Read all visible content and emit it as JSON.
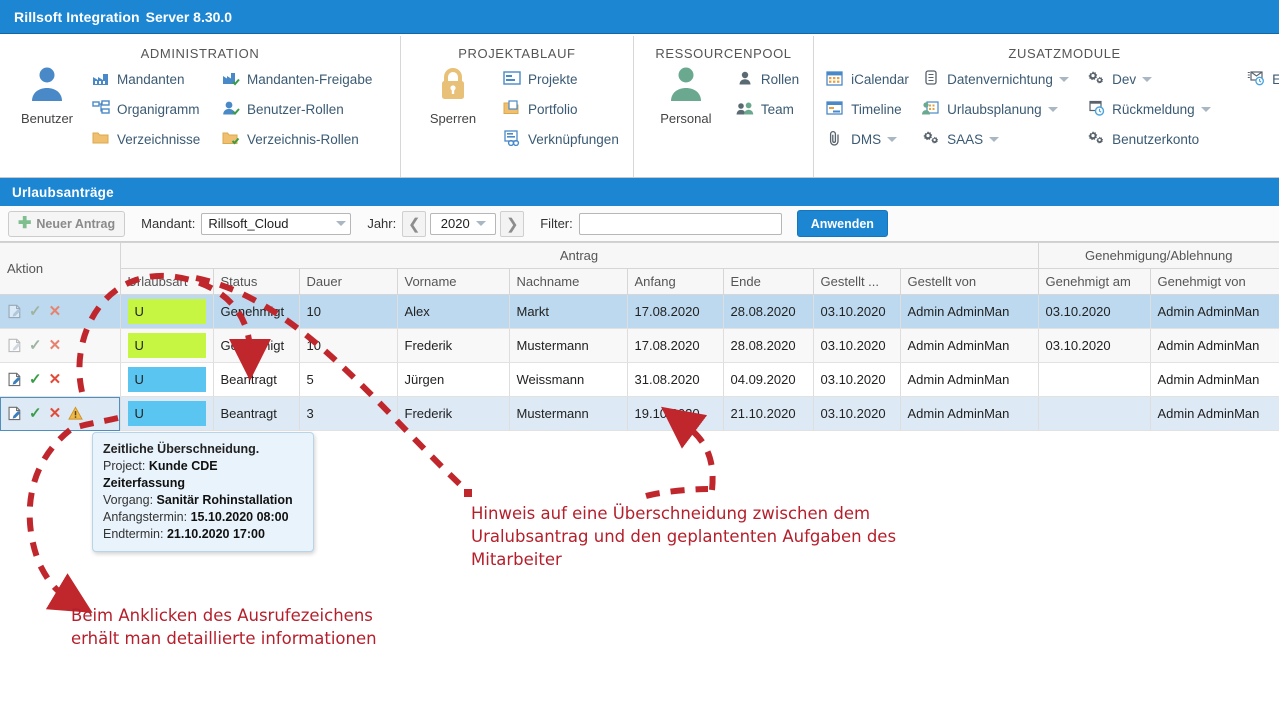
{
  "window": {
    "title_main": "Rillsoft Integration",
    "title_version": "Server 8.30.0"
  },
  "ribbon": {
    "groups": [
      {
        "title": "ADMINISTRATION",
        "big_button": {
          "label": "Benutzer",
          "icon": "user-icon"
        },
        "columns": [
          [
            {
              "label": "Mandanten",
              "icon": "factory-icon"
            },
            {
              "label": "Organigramm",
              "icon": "org-chart-icon"
            },
            {
              "label": "Verzeichnisse",
              "icon": "folder-icon"
            }
          ],
          [
            {
              "label": "Mandanten-Freigabe",
              "icon": "factory-check-icon"
            },
            {
              "label": "Benutzer-Rollen",
              "icon": "user-check-icon"
            },
            {
              "label": "Verzeichnis-Rollen",
              "icon": "folder-check-icon"
            }
          ]
        ]
      },
      {
        "title": "PROJEKTABLAUF",
        "big_button": {
          "label": "Sperren",
          "icon": "lock-icon"
        },
        "columns": [
          [
            {
              "label": "Projekte",
              "icon": "project-icon"
            },
            {
              "label": "Portfolio",
              "icon": "portfolio-icon"
            },
            {
              "label": "Verknüpfungen",
              "icon": "link-icon"
            }
          ]
        ]
      },
      {
        "title": "RESSOURCENPOOL",
        "big_button": {
          "label": "Personal",
          "icon": "person-icon"
        },
        "columns": [
          [
            {
              "label": "Rollen",
              "icon": "role-icon"
            },
            {
              "label": "Team",
              "icon": "team-icon"
            }
          ]
        ]
      },
      {
        "title": "ZUSATZMODULE",
        "columns": [
          [
            {
              "label": "iCalendar",
              "icon": "calendar-icon"
            },
            {
              "label": "Timeline",
              "icon": "timeline-icon"
            },
            {
              "label": "DMS",
              "icon": "paperclip-icon",
              "dropdown": true
            }
          ],
          [
            {
              "label": "Datenvernichtung",
              "icon": "shredder-icon",
              "dropdown": true
            },
            {
              "label": "Urlaubsplanung",
              "icon": "vacation-icon",
              "dropdown": true
            },
            {
              "label": "SAAS",
              "icon": "gears-icon",
              "dropdown": true
            }
          ],
          [
            {
              "label": "Dev",
              "icon": "gears-icon",
              "dropdown": true
            },
            {
              "label": "Rückmeldung",
              "icon": "feedback-clock-icon",
              "dropdown": true
            },
            {
              "label": "Benutzerkonto",
              "icon": "gears-icon"
            }
          ],
          [
            {
              "label": "E-",
              "icon": "email-clock-icon"
            }
          ]
        ]
      }
    ]
  },
  "section": {
    "title": "Urlaubsanträge"
  },
  "toolbar": {
    "new_request_label": "Neuer Antrag",
    "mandant_label": "Mandant:",
    "mandant_value": "Rillsoft_Cloud",
    "year_label": "Jahr:",
    "year_value": "2020",
    "prev_year_icon": "chevron-left-icon",
    "next_year_icon": "chevron-right-icon",
    "filter_label": "Filter:",
    "filter_value": "",
    "filter_placeholder": "",
    "apply_label": "Anwenden"
  },
  "grid": {
    "group_headers": {
      "action": "Aktion",
      "antrag": "Antrag",
      "approval": "Genehmigung/Ablehnung"
    },
    "columns": [
      "Urlaubsart",
      "Status",
      "Dauer",
      "Vorname",
      "Nachname",
      "Anfang",
      "Ende",
      "Gestellt ...",
      "Gestellt von",
      "Genehmigt am",
      "Genehmigt von"
    ],
    "rows": [
      {
        "row_state": "selected",
        "actions": {
          "edit": true,
          "approve_enabled": false,
          "reject_enabled": false,
          "warning": false
        },
        "urlaubsart": "U",
        "urlaubsart_color": "#c6f542",
        "status": "Genehmigt",
        "dauer": "10",
        "vorname": "Alex",
        "nachname": "Markt",
        "anfang": "17.08.2020",
        "ende": "28.08.2020",
        "anfang_alert": false,
        "gestellt_am": "03.10.2020",
        "gestellt_von": "Admin AdminMan",
        "genehmigt_am": "03.10.2020",
        "genehmigt_von": "Admin AdminMan"
      },
      {
        "row_state": "alt",
        "actions": {
          "edit": true,
          "approve_enabled": false,
          "reject_enabled": false,
          "warning": false
        },
        "urlaubsart": "U",
        "urlaubsart_color": "#c6f542",
        "status": "Genehmigt",
        "dauer": "10",
        "vorname": "Frederik",
        "nachname": "Mustermann",
        "anfang": "17.08.2020",
        "ende": "28.08.2020",
        "anfang_alert": false,
        "gestellt_am": "03.10.2020",
        "gestellt_von": "Admin AdminMan",
        "genehmigt_am": "03.10.2020",
        "genehmigt_von": "Admin AdminMan"
      },
      {
        "row_state": "plain",
        "actions": {
          "edit": true,
          "approve_enabled": true,
          "reject_enabled": true,
          "warning": false
        },
        "urlaubsart": "U",
        "urlaubsart_color": "#5bc5f2",
        "status": "Beantragt",
        "dauer": "5",
        "vorname": "Jürgen",
        "nachname": "Weissmann",
        "anfang": "31.08.2020",
        "ende": "04.09.2020",
        "anfang_alert": false,
        "gestellt_am": "03.10.2020",
        "gestellt_von": "Admin AdminMan",
        "genehmigt_am": "",
        "genehmigt_von": "Admin AdminMan"
      },
      {
        "row_state": "focus",
        "actions": {
          "edit": true,
          "approve_enabled": true,
          "reject_enabled": true,
          "warning": true
        },
        "urlaubsart": "U",
        "urlaubsart_color": "#5bc5f2",
        "status": "Beantragt",
        "dauer": "3",
        "vorname": "Frederik",
        "nachname": "Mustermann",
        "anfang": "19.10.2020",
        "ende": "21.10.2020",
        "anfang_alert": true,
        "gestellt_am": "03.10.2020",
        "gestellt_von": "Admin AdminMan",
        "genehmigt_am": "",
        "genehmigt_von": "Admin AdminMan"
      }
    ]
  },
  "tooltip": {
    "title": "Zeitliche Überschneidung.",
    "project_label": "Project:",
    "project_value": "Kunde CDE Zeiterfassung",
    "vorgang_label": "Vorgang:",
    "vorgang_value": "Sanitär Rohinstallation",
    "start_label": "Anfangstermin:",
    "start_value": "15.10.2020 08:00",
    "end_label": "Endtermin:",
    "end_value": "21.10.2020 17:00"
  },
  "annotations": {
    "overlap_note": "Hinweis auf eine Überschneidung zwischen dem Uralubsantrag und den geplantenten Aufgaben des Mitarbeiter",
    "click_note": "Beim Anklicken des Ausrufezeichens erhält man detaillierte informationen",
    "color": "#b51f2b"
  }
}
